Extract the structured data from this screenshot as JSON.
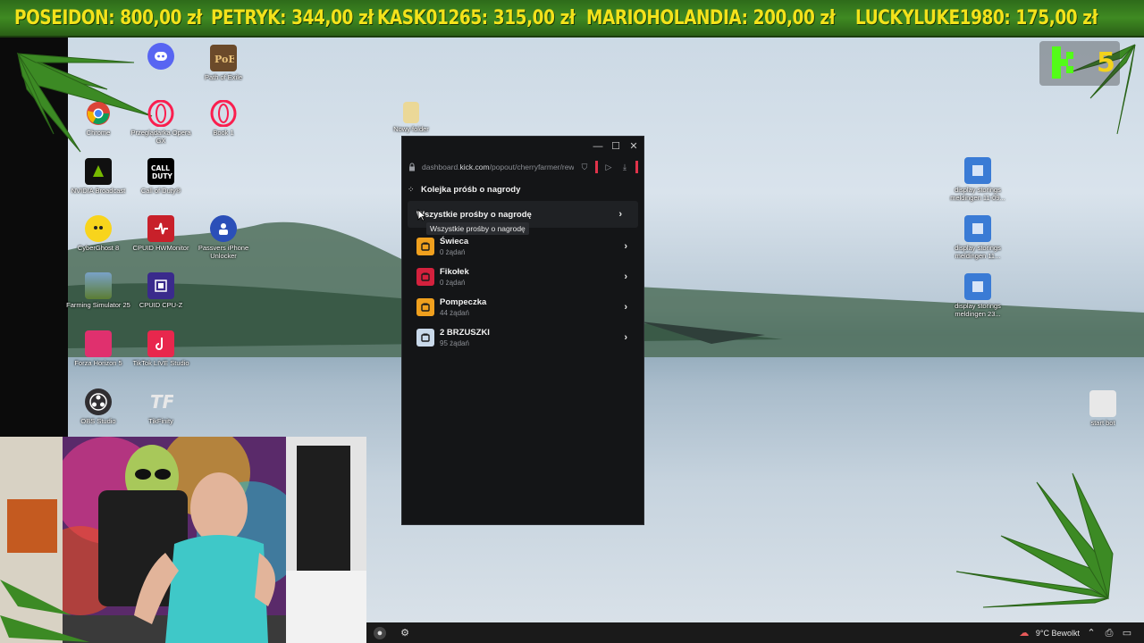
{
  "ticker": [
    {
      "name": "POSEIDON:",
      "amount": "800,00 zł"
    },
    {
      "name": "PETRYK:",
      "amount": "344,00 zł"
    },
    {
      "name": "KASK01265:",
      "amount": "315,00 zł"
    },
    {
      "name": "MARIOHOLANDIA:",
      "amount": "200,00 zł"
    },
    {
      "name": "LUCKYLUKE1980:",
      "amount": "175,00 zł"
    }
  ],
  "desktop_icons": [
    {
      "label": "Path of Exile"
    },
    {
      "label": "Chrome"
    },
    {
      "label": "Przeglądarka Opera GX"
    },
    {
      "label": "Book 1"
    },
    {
      "label": "Nowy folder"
    },
    {
      "label": "NVIDIA Broadcast"
    },
    {
      "label": "Call of Duty®"
    },
    {
      "label": "CyberGhost 8"
    },
    {
      "label": "CPUID HWMonitor"
    },
    {
      "label": "Passvers iPhone Unlocker"
    },
    {
      "label": "Farming Simulator 25"
    },
    {
      "label": "CPUID CPU-Z"
    },
    {
      "label": "Forza Horizon 5"
    },
    {
      "label": "TikTok LIVE Studio"
    },
    {
      "label": "OBS Studio"
    },
    {
      "label": "TikFinity"
    },
    {
      "label": "display storings meldingen 11-09..."
    },
    {
      "label": "display storings meldingen 11..."
    },
    {
      "label": "display storings meldingen 23..."
    },
    {
      "label": "start bot"
    }
  ],
  "kick_window": {
    "url_prefix": "dashboard.",
    "url_domain": "kick.com",
    "url_path": "/popout/cherryfarmer/rewa",
    "header": "Kolejka próśb o nagrody",
    "all_requests": "Wszystkie prośby o nagrodę",
    "tooltip": "Wszystkie prośby o nagrodę",
    "rewards": [
      {
        "name": "Świeca",
        "count": "0 żądań",
        "color": "#f0a01e"
      },
      {
        "name": "Fikołek",
        "count": "0 żądań",
        "color": "#d4213d"
      },
      {
        "name": "Pompeczka",
        "count": "44 żądań",
        "color": "#f0a01e"
      },
      {
        "name": "2 BRZUSZKI",
        "count": "95 żądań",
        "color": "#6a86a8"
      }
    ]
  },
  "taskbar": {
    "weather": "9°C  Bewolkt"
  },
  "overlay": {
    "kick_number": "5"
  }
}
